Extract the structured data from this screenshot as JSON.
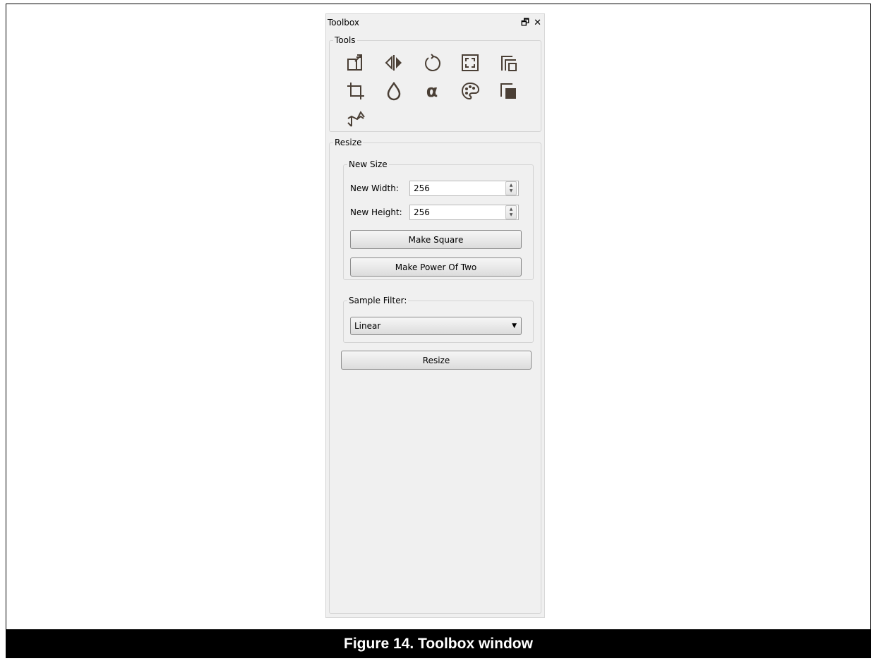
{
  "panel": {
    "title": "Toolbox"
  },
  "tools_group": {
    "label": "Tools",
    "icons": [
      "resize-icon",
      "flip-icon",
      "rotate-icon",
      "fit-icon",
      "copy-icon",
      "crop-icon",
      "drop-icon",
      "alpha-icon",
      "palette-icon",
      "layers-icon",
      "stamp-icon"
    ]
  },
  "resize_group": {
    "label": "Resize",
    "new_size": {
      "label": "New Size",
      "width_label": "New Width:",
      "width_value": "256",
      "height_label": "New Height:",
      "height_value": "256",
      "make_square": "Make Square",
      "make_power_of_two": "Make Power Of Two"
    },
    "sample_filter": {
      "label": "Sample Filter:",
      "selected": "Linear"
    },
    "resize_button": "Resize"
  },
  "caption": "Figure 14. Toolbox window",
  "colors": {
    "panel_bg": "#f0f0f0",
    "caption_bg": "#000000",
    "icon_color": "#4a3f35"
  }
}
